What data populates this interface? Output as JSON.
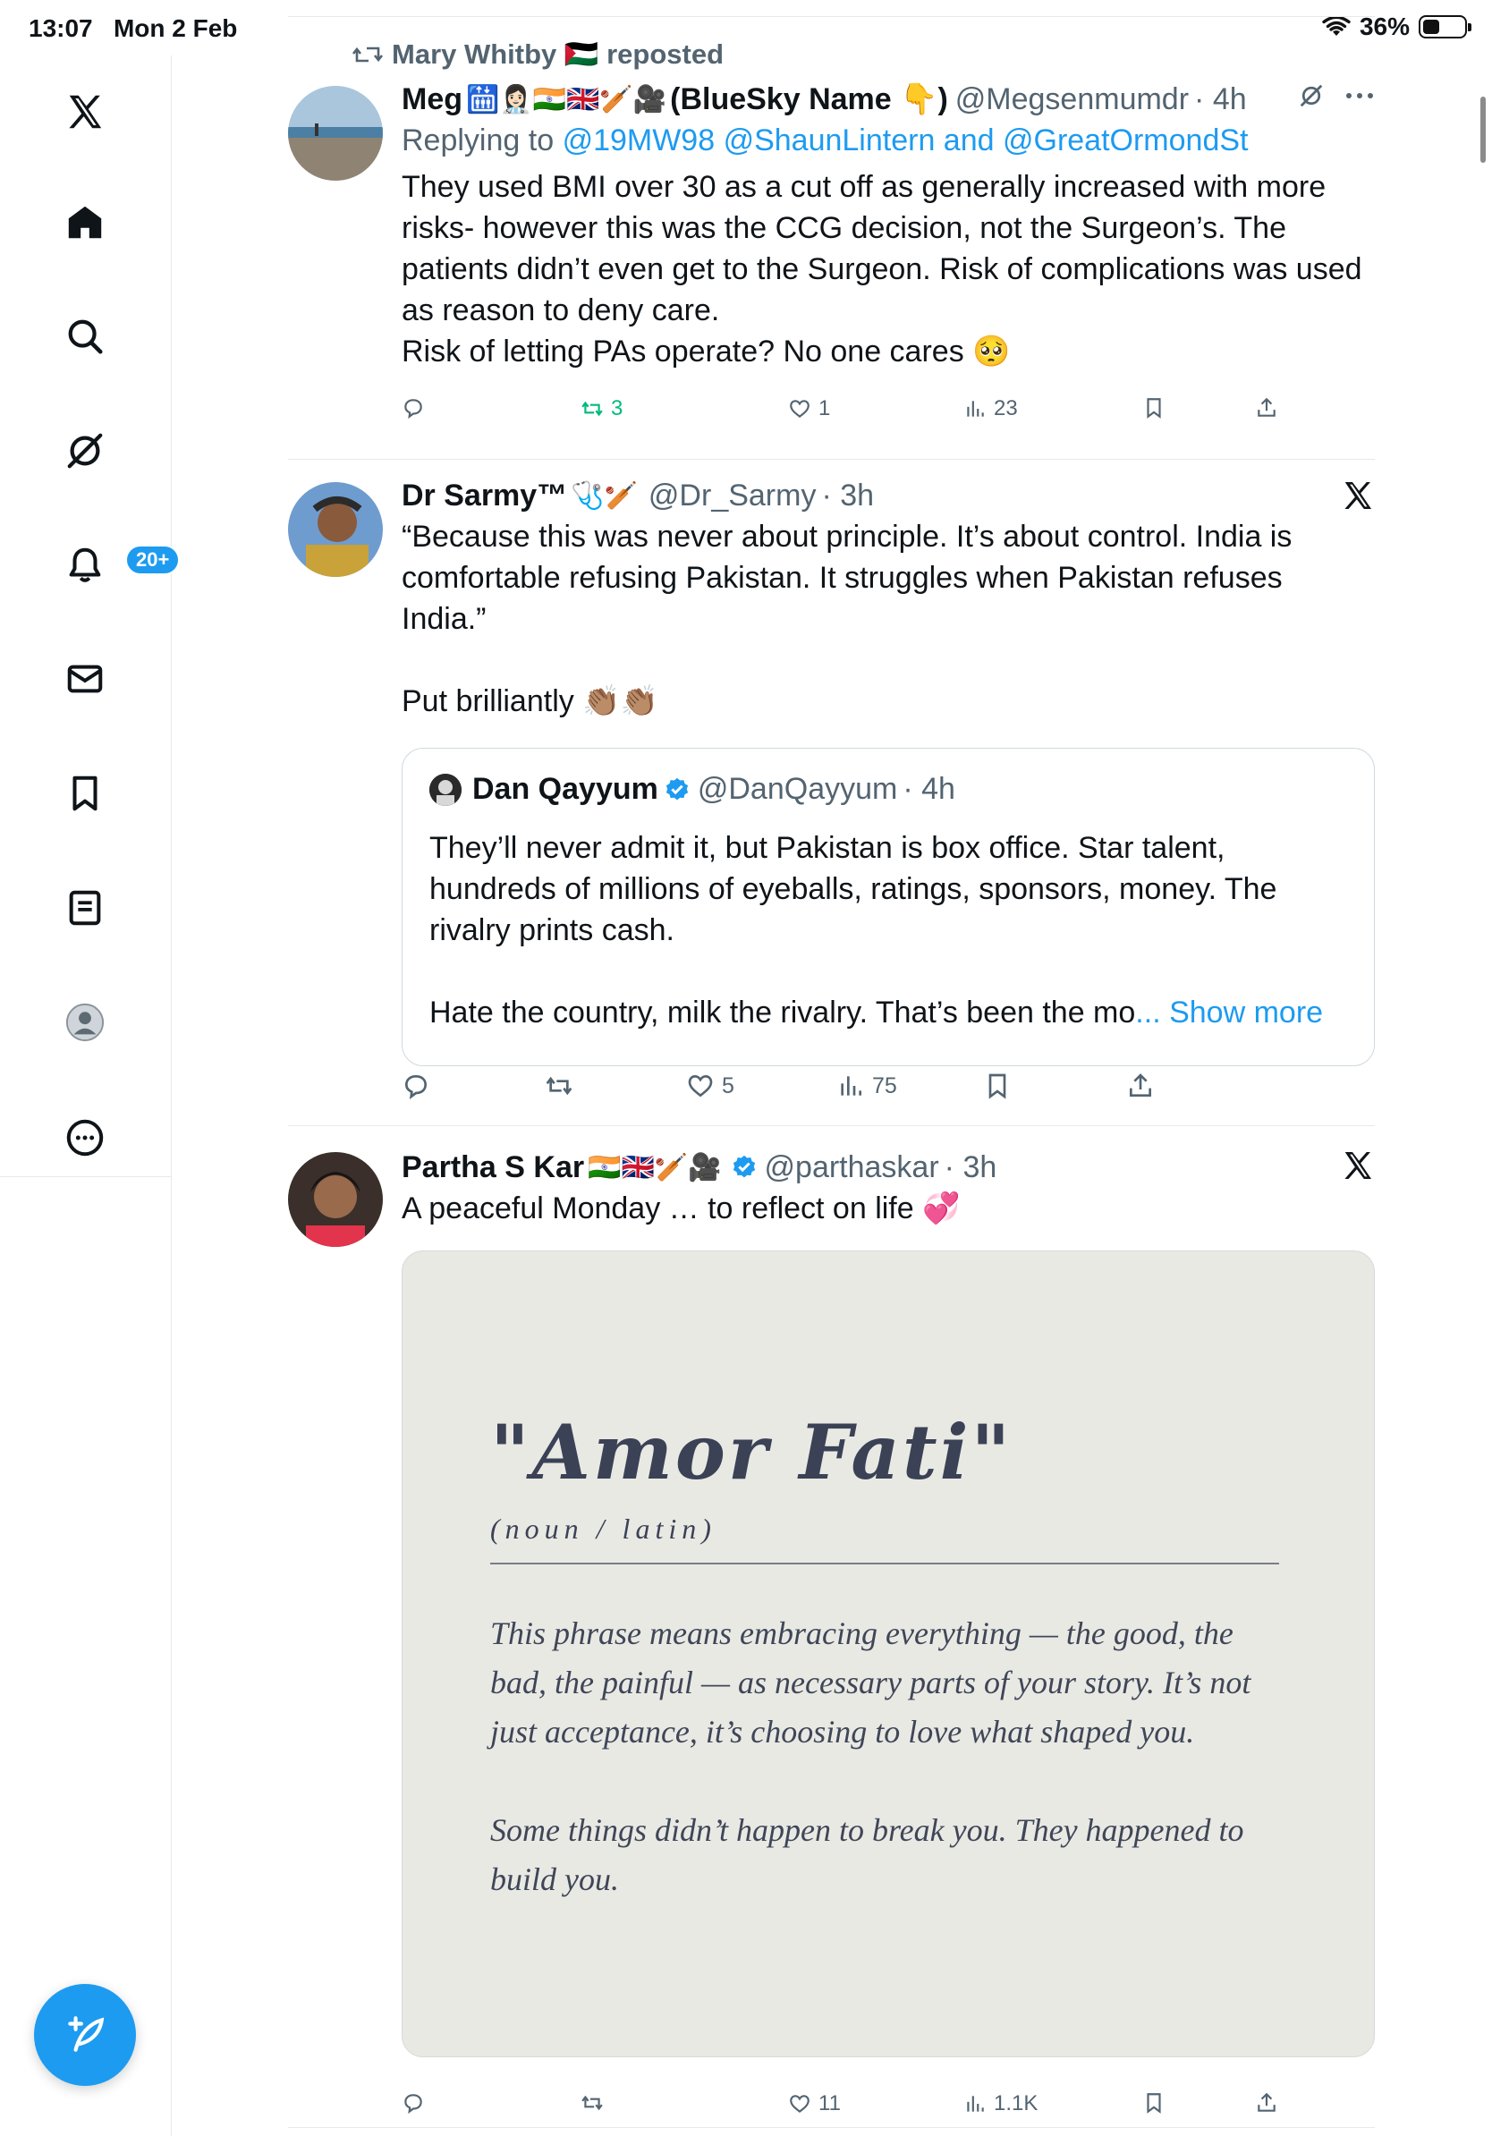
{
  "status_bar": {
    "time": "13:07",
    "date": "Mon 2 Feb",
    "battery": "36%",
    "battery_level": 0.36
  },
  "nav": {
    "notifications_badge": "20+"
  },
  "tweets": [
    {
      "repost_by": "Mary Whitby 🇵🇸 reposted",
      "name": "Meg",
      "emojis": "🛗👩🏻‍⚕️🇮🇳🇬🇧🏏🎥",
      "name_suffix": "(BlueSky Name 👇)",
      "handle": "@Megsenmumdr",
      "time": "· 4h",
      "reply_prefix": "Replying to",
      "reply_targets": "@19MW98 @ShaunLintern and @GreatOrmondSt",
      "text": "They used BMI over 30 as a cut off as generally increased with more\nrisks- however this was the CCG decision, not the Surgeon’s. The\npatients didn’t even get to the Surgeon. Risk of complications was used\nas reason to deny care.\nRisk of letting PAs operate? No one cares 🥺",
      "reposts": "3",
      "likes": "1",
      "views": "23"
    },
    {
      "name": "Dr Sarmy™",
      "emojis": "🩺🏏",
      "handle": "@Dr_Sarmy",
      "time": "· 3h",
      "text": "“Because this was never about principle. It’s about control. India is\ncomfortable refusing Pakistan. It struggles when Pakistan refuses\nIndia.”\n\nPut brilliantly 👏🏽👏🏽",
      "quote": {
        "name": "Dan Qayyum",
        "handle": "@DanQayyum",
        "time": "· 4h",
        "text": "They’ll never admit it, but Pakistan is box office. Star talent,\nhundreds of millions of eyeballs, ratings, sponsors, money. The\nrivalry prints cash.\n\nHate the country, milk the rivalry. That’s been the mo",
        "ellipsis": "... ",
        "show_more": "Show more"
      },
      "likes": "5",
      "views": "75"
    },
    {
      "name": "Partha S Kar",
      "emojis": "🇮🇳🇬🇧🏏🎥",
      "handle": "@parthaskar",
      "time": "· 3h",
      "text": "A peaceful Monday … to reflect on life 💞",
      "media": {
        "title": "\"Amor Fati\"",
        "subtitle": "(noun / latin)",
        "body": "This phrase means embracing everything — the good, the\nbad, the painful — as necessary parts of your story. It’s not\njust acceptance, it’s choosing to love what shaped you.\n\nSome things didn’t happen to break you. They happened to\nbuild you."
      },
      "likes": "11",
      "views": "1.1K"
    }
  ],
  "colors": {
    "accent": "#1d9bf0",
    "repost_green": "#00ba7c",
    "muted": "#536471"
  }
}
